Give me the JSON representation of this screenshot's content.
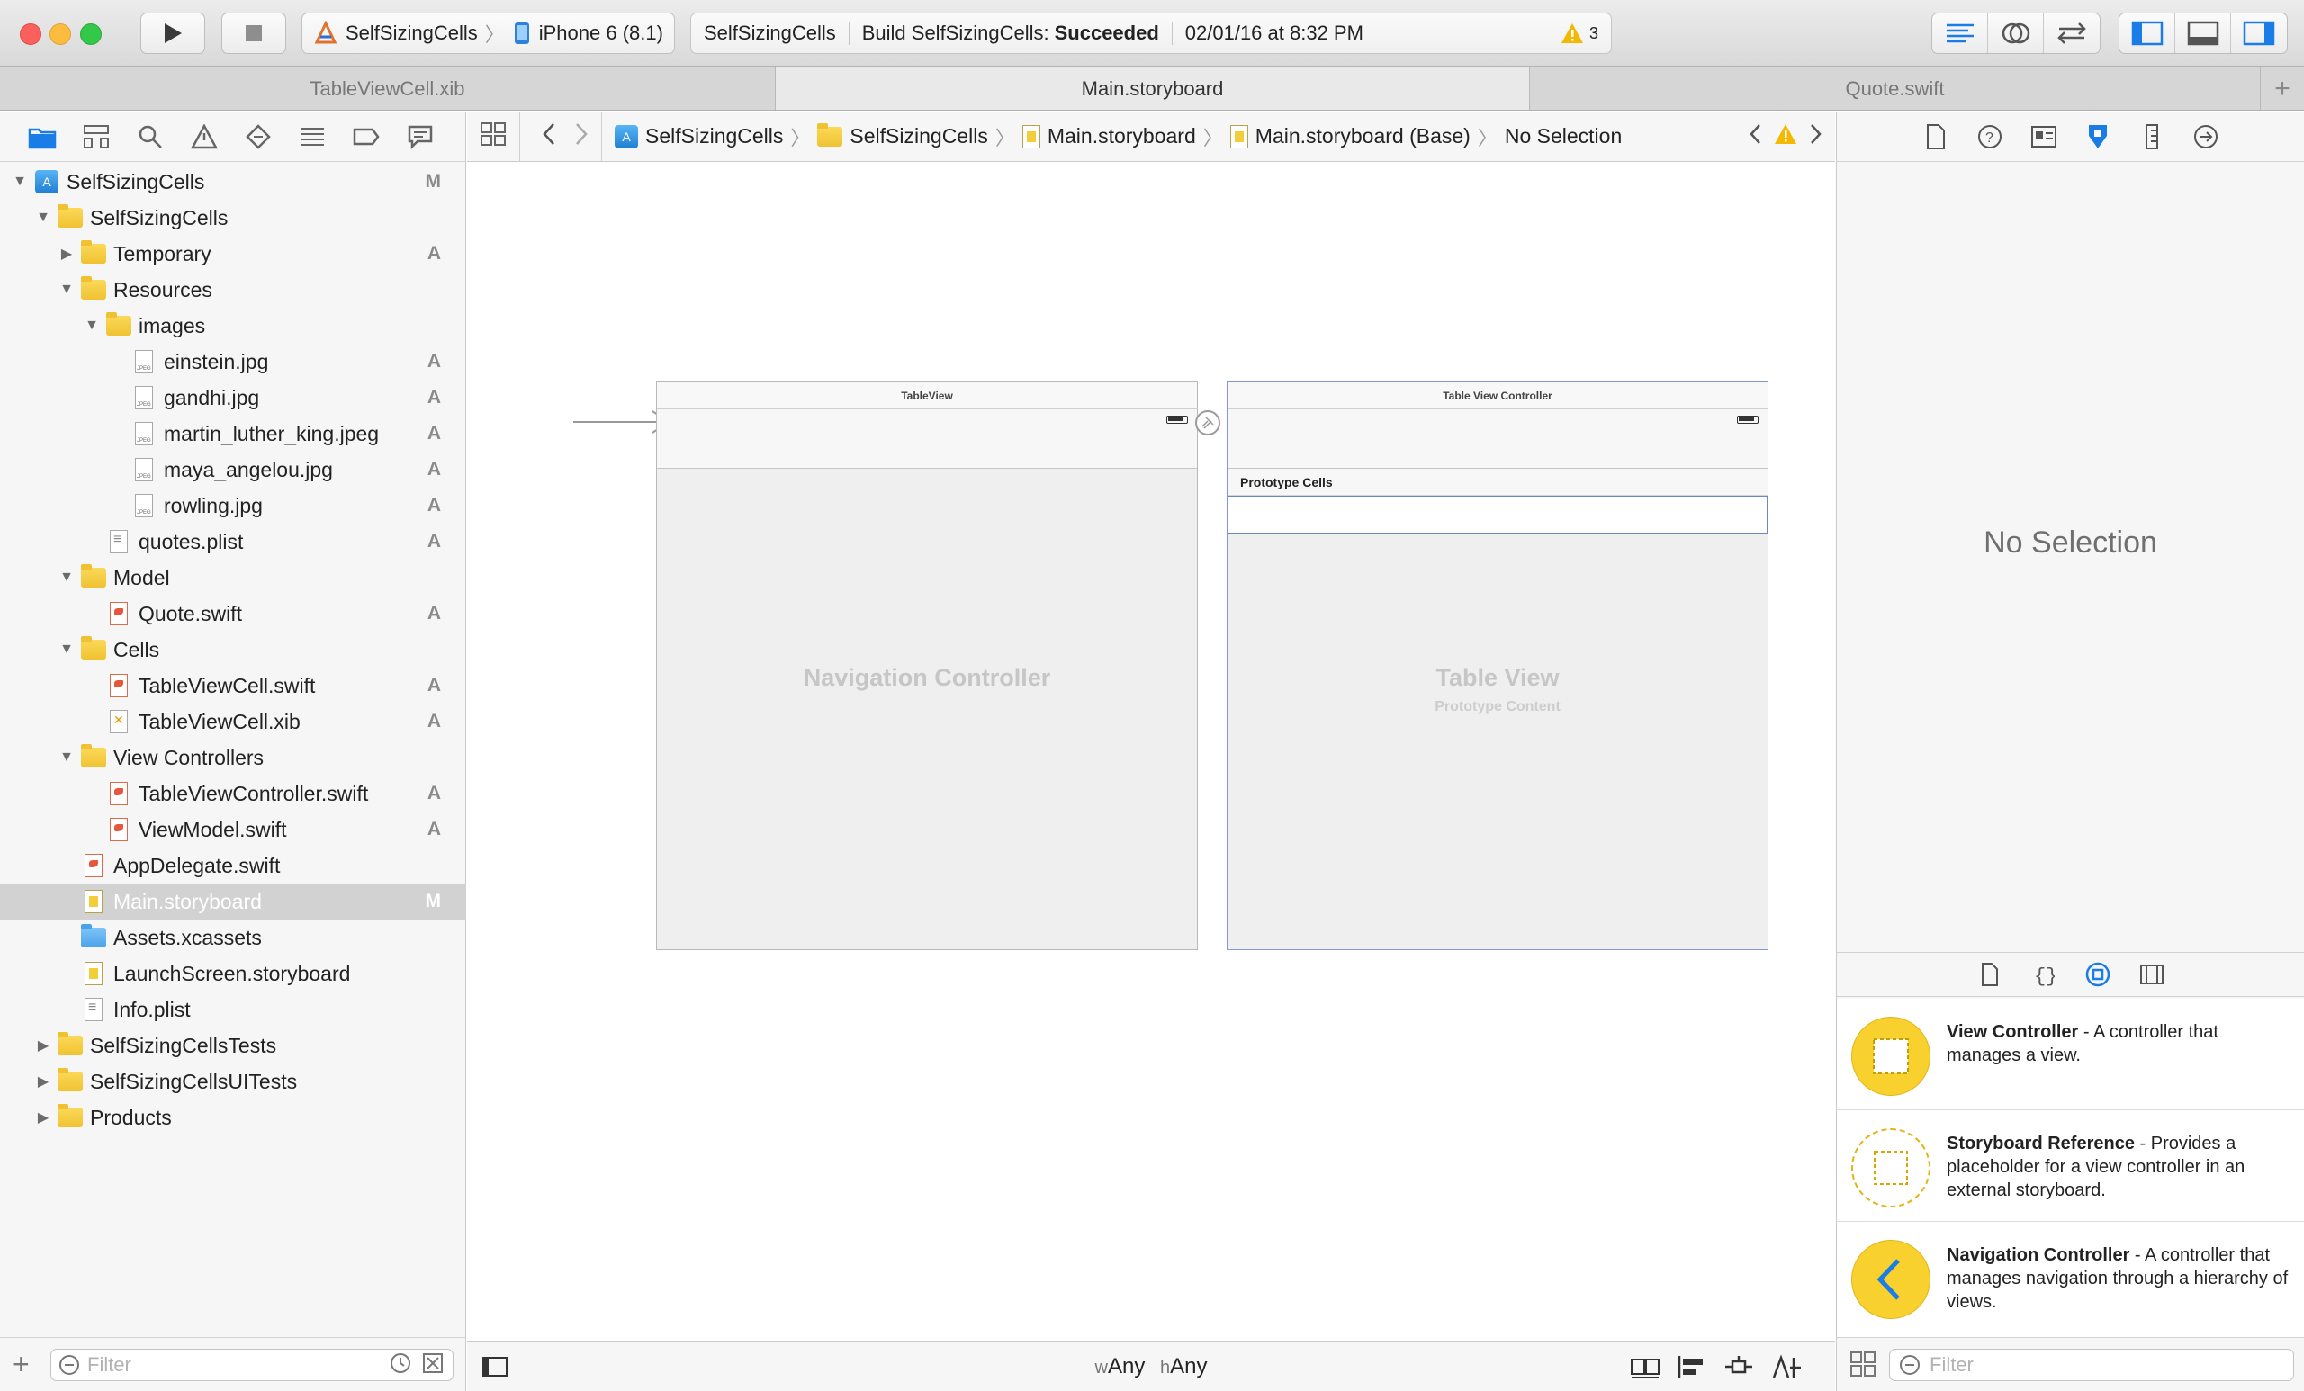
{
  "toolbar": {
    "scheme_name": "SelfSizingCells",
    "device": "iPhone 6 (8.1)",
    "activity_project": "SelfSizingCells",
    "activity_build_prefix": "Build SelfSizingCells:",
    "activity_build_status": "Succeeded",
    "activity_timestamp": "02/01/16 at 8:32 PM",
    "warning_count": "3"
  },
  "tabs": [
    {
      "label": "TableViewCell.xib"
    },
    {
      "label": "Main.storyboard"
    },
    {
      "label": "Quote.swift"
    }
  ],
  "navigator": {
    "tree": [
      {
        "label": "SelfSizingCells",
        "status": "M"
      },
      {
        "label": "SelfSizingCells",
        "status": ""
      },
      {
        "label": "Temporary",
        "status": "A"
      },
      {
        "label": "Resources",
        "status": ""
      },
      {
        "label": "images",
        "status": ""
      },
      {
        "label": "einstein.jpg",
        "status": "A"
      },
      {
        "label": "gandhi.jpg",
        "status": "A"
      },
      {
        "label": "martin_luther_king.jpeg",
        "status": "A"
      },
      {
        "label": "maya_angelou.jpg",
        "status": "A"
      },
      {
        "label": "rowling.jpg",
        "status": "A"
      },
      {
        "label": "quotes.plist",
        "status": "A"
      },
      {
        "label": "Model",
        "status": ""
      },
      {
        "label": "Quote.swift",
        "status": "A"
      },
      {
        "label": "Cells",
        "status": ""
      },
      {
        "label": "TableViewCell.swift",
        "status": "A"
      },
      {
        "label": "TableViewCell.xib",
        "status": "A"
      },
      {
        "label": "View Controllers",
        "status": ""
      },
      {
        "label": "TableViewController.swift",
        "status": "A"
      },
      {
        "label": "ViewModel.swift",
        "status": "A"
      },
      {
        "label": "AppDelegate.swift",
        "status": ""
      },
      {
        "label": "Main.storyboard",
        "status": "M"
      },
      {
        "label": "Assets.xcassets",
        "status": ""
      },
      {
        "label": "LaunchScreen.storyboard",
        "status": ""
      },
      {
        "label": "Info.plist",
        "status": ""
      },
      {
        "label": "SelfSizingCellsTests",
        "status": ""
      },
      {
        "label": "SelfSizingCellsUITests",
        "status": ""
      },
      {
        "label": "Products",
        "status": ""
      }
    ],
    "filter_placeholder": "Filter"
  },
  "jumpbar": {
    "crumbs": [
      "SelfSizingCells",
      "SelfSizingCells",
      "Main.storyboard",
      "Main.storyboard (Base)",
      "No Selection"
    ]
  },
  "canvas": {
    "scene1_title": "TableView",
    "scene1_label": "Navigation Controller",
    "scene2_title": "Table View Controller",
    "scene2_proto_header": "Prototype Cells",
    "scene2_label": "Table View",
    "scene2_sublabel": "Prototype Content"
  },
  "size_class": {
    "w_prefix": "w",
    "w_value": "Any",
    "h_prefix": "h",
    "h_value": "Any"
  },
  "utilities": {
    "no_selection": "No Selection",
    "library": [
      {
        "title": "View Controller",
        "desc": " - A controller that manages a view."
      },
      {
        "title": "Storyboard Reference",
        "desc": " - Provides a placeholder for a view controller in an external storyboard."
      },
      {
        "title": "Navigation Controller",
        "desc": " - A controller that manages navigation through a hierarchy of views."
      }
    ],
    "filter_placeholder": "Filter"
  },
  "colors": {
    "accent": "#1a7ce6",
    "library_yellow": "#f8d12e",
    "selection_gray": "#d2d2d2"
  }
}
